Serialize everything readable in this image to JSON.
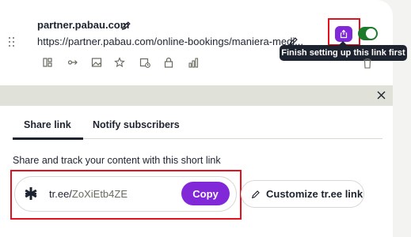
{
  "link": {
    "title": "partner.pabau.com",
    "url": "https://partner.pabau.com/online-bookings/maniera-medi..."
  },
  "toolbar_icons": [
    "layout-icon",
    "redirect-icon",
    "image-icon",
    "star-icon",
    "schedule-icon",
    "lock-icon",
    "analytics-icon"
  ],
  "tooltip": "Finish setting up this link first",
  "toggle": {
    "on": true
  },
  "tabs": [
    {
      "label": "Share link",
      "active": true
    },
    {
      "label": "Notify subscribers",
      "active": false
    }
  ],
  "share": {
    "heading": "Share and track your content with this short link",
    "short_prefix": "tr.ee/",
    "short_slug": "ZoXiEtb4ZE",
    "copy_label": "Copy",
    "customize_label": "Customize tr.ee link"
  },
  "colors": {
    "accent": "#8129d9",
    "highlight": "#e3111d",
    "toggle_on": "#1c7a2b",
    "text": "#1e2330"
  }
}
